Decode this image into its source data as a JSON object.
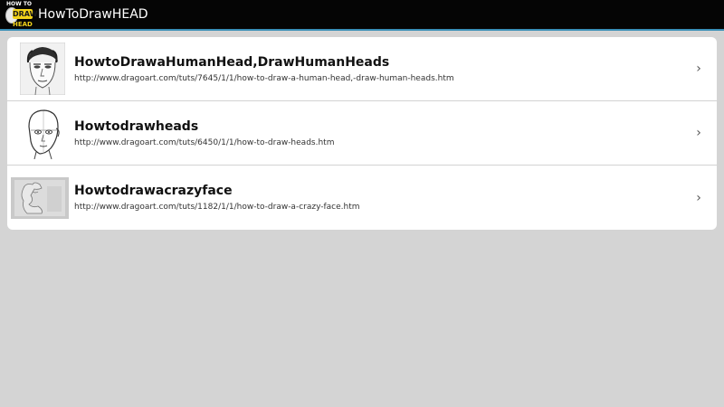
{
  "app": {
    "title": "HowToDrawHEAD",
    "logo": {
      "line1": "HOW TO",
      "line2": "DRAW",
      "line3": "HEAD"
    }
  },
  "colors": {
    "action_bar": "#050505",
    "action_bar_divider": "#3a8fb7",
    "background": "#d4d4d4",
    "card": "#ffffff",
    "logo_accent": "#f2d21a"
  },
  "items": [
    {
      "title": "HowtoDrawaHumanHead,DrawHumanHeads",
      "url": "http://www.dragoart.com/tuts/7645/1/1/how-to-draw-a-human-head,-draw-human-heads.htm",
      "thumbnail_icon": "human-head-sketch-thumbnail"
    },
    {
      "title": "Howtodrawheads",
      "url": "http://www.dragoart.com/tuts/6450/1/1/how-to-draw-heads.htm",
      "thumbnail_icon": "head-outline-thumbnail"
    },
    {
      "title": "Howtodrawacrazyface",
      "url": "http://www.dragoart.com/tuts/1182/1/1/how-to-draw-a-crazy-face.htm",
      "thumbnail_icon": "crazy-face-thumbnail"
    }
  ],
  "chevron_icon": "chevron-right-icon",
  "chevron_glyph": "›"
}
